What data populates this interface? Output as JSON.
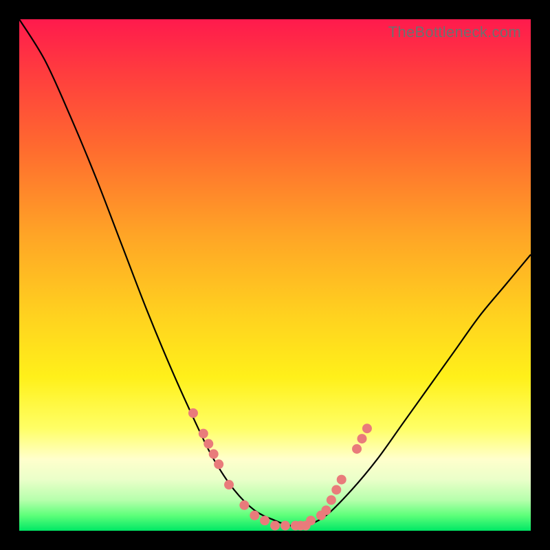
{
  "watermark": "TheBottleneck.com",
  "colors": {
    "frame": "#000000",
    "curve": "#000000",
    "dot_fill": "#e97b7b",
    "dot_stroke": "#c94f4f"
  },
  "chart_data": {
    "type": "line",
    "title": "",
    "xlabel": "",
    "ylabel": "",
    "xlim": [
      0,
      100
    ],
    "ylim": [
      0,
      100
    ],
    "series": [
      {
        "name": "bottleneck-curve",
        "x": [
          0,
          5,
          10,
          15,
          20,
          25,
          30,
          35,
          38,
          42,
          46,
          50,
          53,
          56,
          60,
          65,
          70,
          75,
          80,
          85,
          90,
          95,
          100
        ],
        "y": [
          100,
          92,
          81,
          69,
          56,
          43,
          31,
          20,
          14,
          8,
          4,
          2,
          1,
          1,
          3,
          8,
          14,
          21,
          28,
          35,
          42,
          48,
          54
        ]
      }
    ],
    "scatter": [
      {
        "name": "highlighted-points",
        "x": [
          34,
          36,
          37,
          38,
          39,
          41,
          44,
          46,
          48,
          50,
          52,
          54,
          55,
          56,
          57,
          59,
          60,
          61,
          62,
          63,
          66,
          67,
          68
        ],
        "y": [
          23,
          19,
          17,
          15,
          13,
          9,
          5,
          3,
          2,
          1,
          1,
          1,
          1,
          1,
          2,
          3,
          4,
          6,
          8,
          10,
          16,
          18,
          20
        ]
      }
    ]
  }
}
